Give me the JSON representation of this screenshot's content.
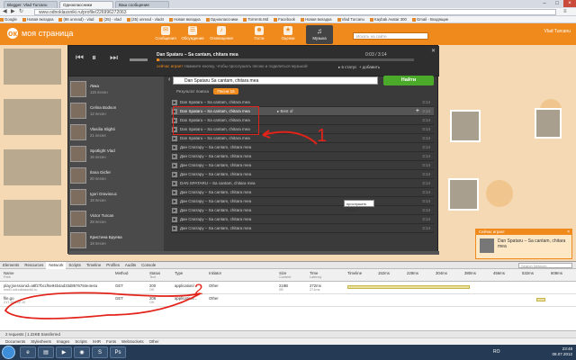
{
  "browser": {
    "tabs": [
      "Blogger: Vlad Turcanu",
      "Одноклассники",
      "Ваш сообщение"
    ],
    "url": "www.odnoklassniki.ru/profile/226996272063",
    "bookmarks": [
      "Google",
      "Новая вкладка",
      "(86 unread) - vlad",
      "(25) - vlad",
      "(35) unread - vlad4",
      "Новая вкладка",
      "Одноклассники",
      "Torrents.Md",
      "Facebook",
      "Новая вкладка",
      "Vlad Turcanu",
      "Kaybak Avatar 300",
      "Gmail - Входящие"
    ],
    "user_menu": "Vlad Turcanu"
  },
  "site": {
    "logo_text": "моя страница",
    "nav": [
      {
        "label": "Сообщения",
        "icon": "envelope-icon"
      },
      {
        "label": "Обсуждения",
        "icon": "chat-icon"
      },
      {
        "label": "Оповещения",
        "icon": "bell-icon"
      },
      {
        "label": "Гости",
        "icon": "footprints-icon"
      },
      {
        "label": "Оценки",
        "icon": "star-icon"
      }
    ],
    "music_label": "Музыка",
    "search_placeholder": "Искать на сайте",
    "user": "Vlad Turcanu"
  },
  "player": {
    "now_title": "Dan Spataru – Sa cantam, chitara mea",
    "time": "0:03 / 3:14",
    "now_playing_label": "сейчас играет",
    "now_playing_text": "Нажмите кнопку, чтобы прослушать песню и поделиться музыкой",
    "status_btn": "в статус",
    "add_btn": "добавить",
    "playlists": [
      {
        "name": "Лика",
        "count": "116 песен"
      },
      {
        "name": "Celina Bodson",
        "count": "12 песен"
      },
      {
        "name": "Vlasilia Slighti",
        "count": "21 песня"
      },
      {
        "name": "Spotlight Vlad",
        "count": "16 песен"
      },
      {
        "name": "Ilana Gicfer",
        "count": "20 песен"
      },
      {
        "name": "Igori Graviscuc",
        "count": "18 песен"
      },
      {
        "name": "Victor Turcan",
        "count": "28 песен"
      },
      {
        "name": "Кристина Бруева",
        "count": "18 песен"
      }
    ],
    "query": "Dan Spataru Sa cantam, chitara mea",
    "find_btn": "Найти",
    "tabs": [
      "Результат поиска",
      "Песни 16"
    ],
    "results": [
      {
        "title": "Dan Spataru – Sa cantam, chitara mea",
        "time": "3:14"
      },
      {
        "title": "Dan Spataru – Sa cantam, chitara mea",
        "time": "3:14"
      },
      {
        "title": "Dan Spataru – Sa cantam, chitara mea",
        "time": "3:14"
      },
      {
        "title": "Dan Spataru – Sa cantam, chitara mea",
        "time": "3:14"
      },
      {
        "title": "Dan Spataru – Sa cantam, chitara mea",
        "time": "3:14"
      },
      {
        "title": "Дан Спатару – Sa cantam, chitara mea",
        "time": "3:14"
      },
      {
        "title": "Дан Спатару – Sa cantam, chitara mea",
        "time": "3:14"
      },
      {
        "title": "Дан Спатару – Sa cantam, chitara mea",
        "time": "3:14"
      },
      {
        "title": "Дан Спатару – Sa cantam, chitara mea",
        "time": "3:14"
      },
      {
        "title": "DAN SPATARU – Sa cantam, chitara mea",
        "time": "3:14"
      },
      {
        "title": "Дан Спатару – Sa cantam, chitara mea",
        "time": "3:14"
      },
      {
        "title": "Дан Спатару – Sa cantam, chitara mea",
        "time": "3:14"
      },
      {
        "title": "Дан Спатару – Sa cantam, chitara mea",
        "time": "3:14"
      },
      {
        "title": "Дан Спатару – Sa cantam, chitara mea",
        "time": "3:14"
      },
      {
        "title": "Дан Спатару – Sa cantam, chitara mea",
        "time": "3:14"
      }
    ],
    "best_of_label": "Best of",
    "tooltip": "прослушать песню"
  },
  "now_popup": {
    "header": "Сейчас играет",
    "title": "Dan Spataru – Sa cantam, chitara mea"
  },
  "devtools": {
    "tabs": [
      "Elements",
      "Resources",
      "Network",
      "Scripts",
      "Timeline",
      "Profiles",
      "Audits",
      "Console"
    ],
    "search_placeholder": "Search Network",
    "columns": [
      {
        "name": "Name",
        "sub": "Path"
      },
      {
        "name": "Method",
        "sub": ""
      },
      {
        "name": "Status",
        "sub": "Text"
      },
      {
        "name": "Type",
        "sub": ""
      },
      {
        "name": "Initiator",
        "sub": ""
      },
      {
        "name": "Size",
        "sub": "Content"
      },
      {
        "name": "Time",
        "sub": "Latency"
      },
      {
        "name": "Timeline",
        "sub": ""
      }
    ],
    "timeline_ticks": [
      "152ms",
      "228ms",
      "304ms",
      "380ms",
      "456ms",
      "532ms",
      "608ms"
    ],
    "requests": [
      {
        "name": "play;jsessionid=a8f27bccf6e94b4ad33d8576784e4e4a",
        "path": "wmf1.odnoklassniki.ru",
        "method": "GET",
        "status": "200",
        "status_text": "OK",
        "type": "application/...",
        "initiator": "Other",
        "size": "219B",
        "content": "0B",
        "time": "272ms",
        "latency": "271ms"
      },
      {
        "name": "file.go",
        "path": "217.20.152.10",
        "method": "GET",
        "status": "206",
        "status_text": "OK",
        "type": "application/...",
        "initiator": "Other",
        "size": "",
        "content": "",
        "time": "",
        "latency": ""
      }
    ],
    "status": "2 requests  |  1.22KB transferred",
    "bottom_tabs": [
      "Documents",
      "Stylesheets",
      "Images",
      "Scripts",
      "XHR",
      "Fonts",
      "WebSockets",
      "Other"
    ]
  },
  "taskbar": {
    "lang": "RO",
    "time": "23:48",
    "date": "08.07.2012"
  },
  "annotations": [
    "1",
    "2"
  ]
}
